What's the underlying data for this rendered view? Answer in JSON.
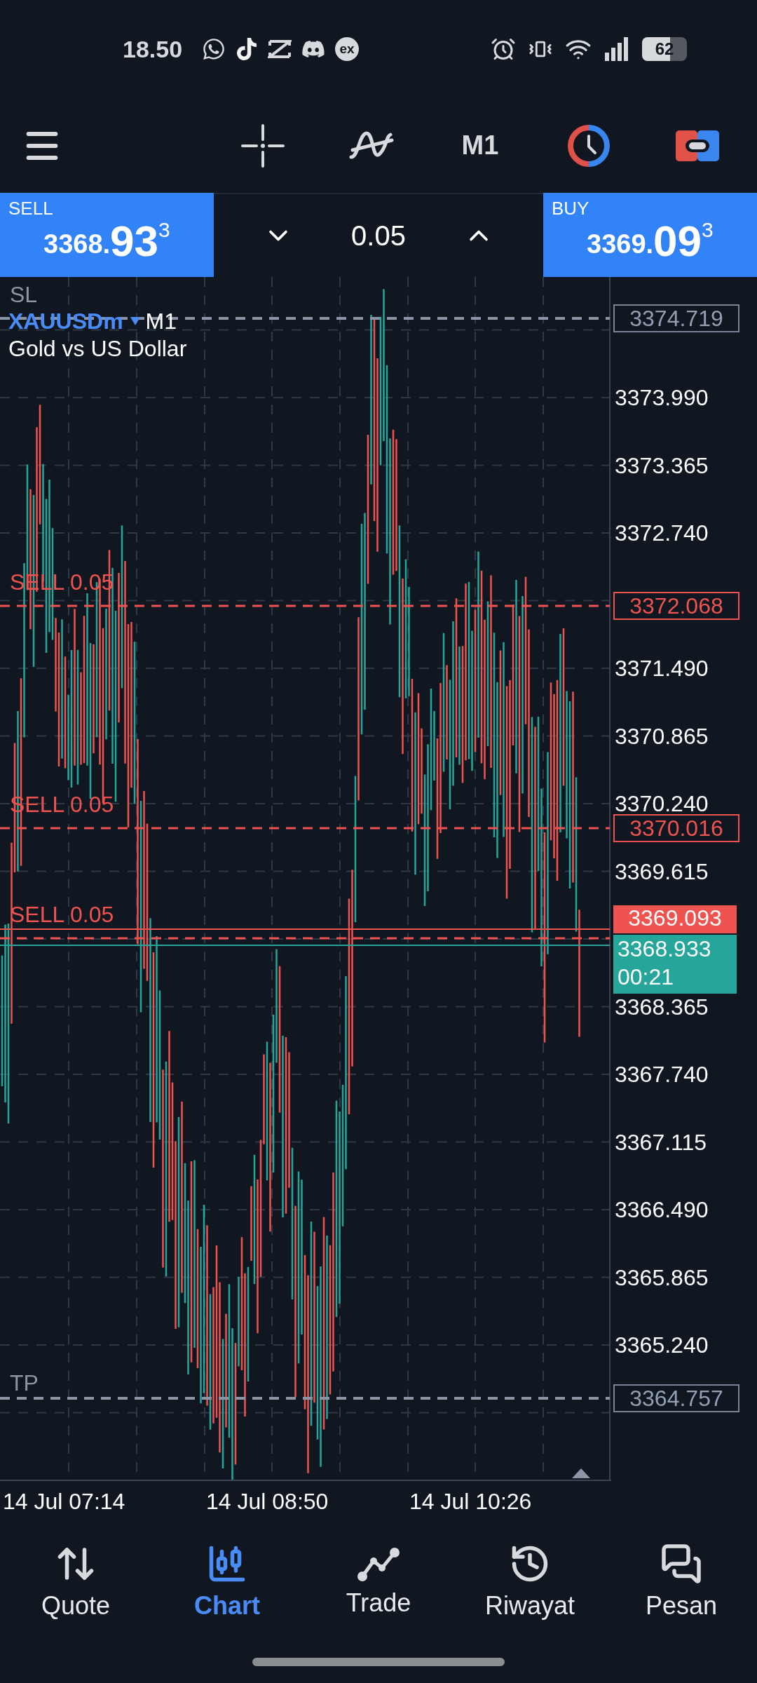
{
  "status_bar": {
    "time": "18.50",
    "app_badge_text": "ex",
    "battery": "62"
  },
  "toolbar": {
    "timeframe": "M1"
  },
  "trade_bar": {
    "sell": {
      "label": "SELL",
      "price_prefix": "3368.",
      "price_big": "93",
      "price_sup": "3"
    },
    "volume": "0.05",
    "buy": {
      "label": "BUY",
      "price_prefix": "3369.",
      "price_big": "09",
      "price_sup": "3"
    }
  },
  "chart": {
    "symbol": "XAUUSDm",
    "timeframe": "M1",
    "description": "Gold vs US Dollar",
    "price_ticks": [
      "3373.990",
      "3373.365",
      "3372.740",
      "3371.490",
      "3370.865",
      "3370.240",
      "3369.615",
      "3368.365",
      "3367.740",
      "3367.115",
      "3366.490",
      "3365.865",
      "3365.240"
    ],
    "order_lines": [
      {
        "kind": "stop_loss",
        "label": "SL",
        "price": "3374.719"
      },
      {
        "kind": "sell",
        "label": "SELL 0.05",
        "price": "3372.068"
      },
      {
        "kind": "sell",
        "label": "SELL 0.05",
        "price": "3370.016"
      },
      {
        "kind": "sell",
        "label": "SELL 0.05"
      },
      {
        "kind": "take_profit",
        "label": "TP",
        "price": "3364.757"
      }
    ],
    "ask": {
      "price": "3369.093"
    },
    "bid": {
      "price": "3368.933",
      "countdown": "00:21"
    },
    "time_labels": [
      "14 Jul 07:14",
      "14 Jul 08:50",
      "14 Jul 10:26"
    ]
  },
  "nav": [
    {
      "kind": "quote",
      "label": "Quote",
      "selected": false
    },
    {
      "kind": "chart",
      "label": "Chart",
      "selected": true
    },
    {
      "kind": "trade",
      "label": "Trade",
      "selected": false
    },
    {
      "kind": "history",
      "label": "Riwayat",
      "selected": false
    },
    {
      "kind": "messages",
      "label": "Pesan",
      "selected": false
    }
  ]
}
